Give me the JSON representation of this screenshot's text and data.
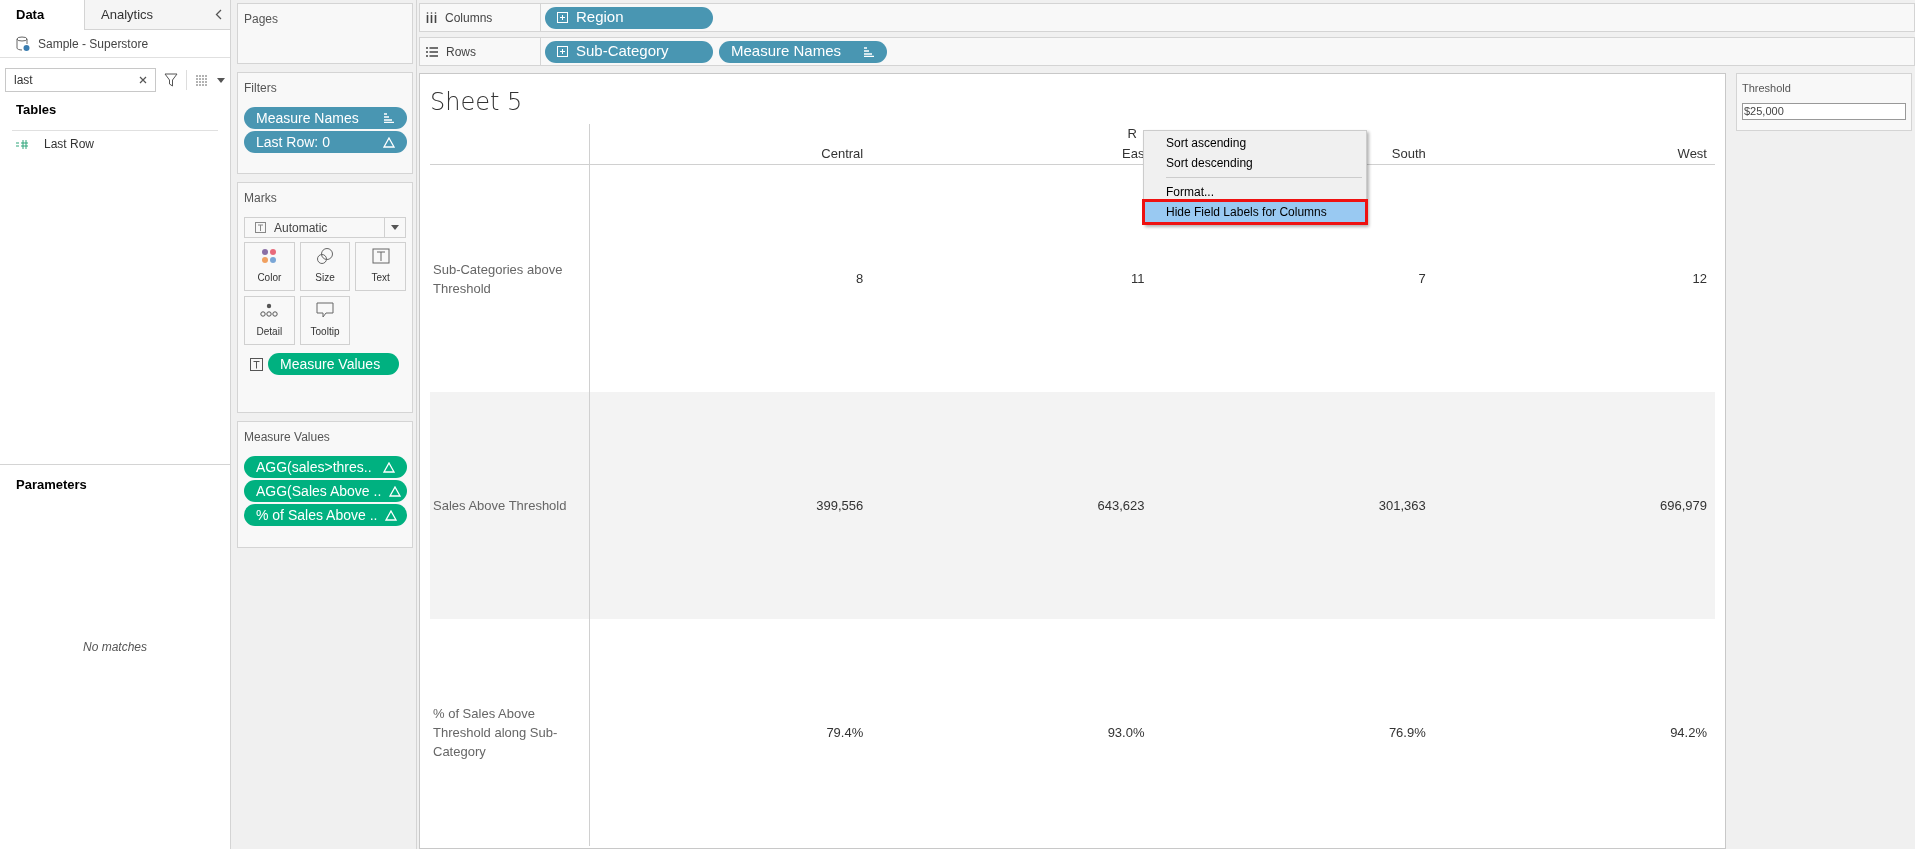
{
  "left_panel": {
    "tabs": [
      {
        "label": "Data",
        "selected": true
      },
      {
        "label": "Analytics",
        "selected": false
      }
    ],
    "data_source": "Sample - Superstore",
    "search": {
      "value": "last"
    },
    "tables_heading": "Tables",
    "fields": [
      {
        "label": "Last Row"
      }
    ],
    "parameters_heading": "Parameters",
    "empty_message": "No matches"
  },
  "pages": {
    "title": "Pages"
  },
  "filters": {
    "title": "Filters",
    "pills": [
      {
        "label": "Measure Names",
        "kind": "sorted"
      },
      {
        "label": "Last Row: 0",
        "kind": "calc"
      }
    ]
  },
  "marks": {
    "title": "Marks",
    "mark_type": "Automatic",
    "buttons": [
      {
        "label": "Color",
        "kind": "color"
      },
      {
        "label": "Size",
        "kind": "size"
      },
      {
        "label": "Text",
        "kind": "text"
      },
      {
        "label": "Detail",
        "kind": "detail"
      },
      {
        "label": "Tooltip",
        "kind": "tooltip"
      }
    ],
    "pills": [
      {
        "label": "Measure Values",
        "kind": "measure"
      }
    ]
  },
  "measure_values": {
    "title": "Measure Values",
    "pills": [
      {
        "label": "AGG(sales>thres..",
        "kind": "measure_calc"
      },
      {
        "label": "AGG(Sales Above ..",
        "kind": "measure_calc"
      },
      {
        "label": "% of Sales Above ..",
        "kind": "measure_calc"
      }
    ]
  },
  "shelves": [
    {
      "label": "Columns",
      "kind": "columns",
      "pills": [
        {
          "label": "Region",
          "kind": "expandable"
        }
      ]
    },
    {
      "label": "Rows",
      "kind": "rows",
      "pills": [
        {
          "label": "Sub-Category",
          "kind": "expandable"
        },
        {
          "label": "Measure Names",
          "kind": "sorted"
        }
      ]
    }
  ],
  "sheet": {
    "title": "Sheet 5",
    "header_label": "R",
    "columns": [
      "Central",
      "Eas",
      "South",
      "West"
    ],
    "rows": [
      {
        "label": "Sub-Categories above Threshold",
        "shaded": false,
        "cells": [
          "8",
          "11",
          "7",
          "12"
        ]
      },
      {
        "label": "Sales Above Threshold",
        "shaded": true,
        "cells": [
          "399,556",
          "643,623",
          "301,363",
          "696,979"
        ]
      },
      {
        "label": "% of Sales Above Threshold along Sub-Category",
        "shaded": false,
        "cells": [
          "79.4%",
          "93.0%",
          "76.9%",
          "94.2%"
        ]
      }
    ]
  },
  "context_menu": {
    "items": [
      {
        "kind": "item",
        "label": "Sort ascending",
        "selected": false
      },
      {
        "kind": "item",
        "label": "Sort descending",
        "selected": false
      },
      {
        "kind": "separator"
      },
      {
        "kind": "item",
        "label": "Format...",
        "selected": false
      },
      {
        "kind": "item",
        "label": "Hide Field Labels for Columns",
        "selected": true
      }
    ]
  },
  "parameter": {
    "title": "Threshold",
    "value": "$25,000"
  }
}
